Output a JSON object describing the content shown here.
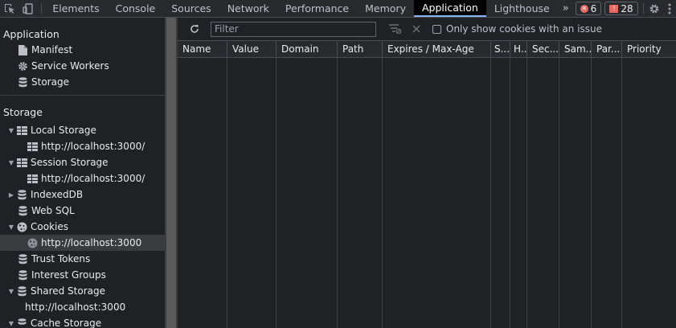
{
  "topbar": {
    "tabs": [
      "Elements",
      "Console",
      "Sources",
      "Network",
      "Performance",
      "Memory",
      "Application",
      "Lighthouse"
    ],
    "active_tab": "Application",
    "errors_count": "6",
    "issues_count": "28"
  },
  "sidebar": {
    "application_title": "Application",
    "application_items": [
      "Manifest",
      "Service Workers",
      "Storage"
    ],
    "storage_title": "Storage",
    "local_storage": "Local Storage",
    "local_storage_origin": "http://localhost:3000/",
    "session_storage": "Session Storage",
    "session_storage_origin": "http://localhost:3000/",
    "indexeddb": "IndexedDB",
    "websql": "Web SQL",
    "cookies": "Cookies",
    "cookies_origin": "http://localhost:3000",
    "trust_tokens": "Trust Tokens",
    "interest_groups": "Interest Groups",
    "shared_storage": "Shared Storage",
    "shared_storage_origin": "http://localhost:3000",
    "cache_storage": "Cache Storage"
  },
  "toolbar": {
    "filter_placeholder": "Filter",
    "only_issues_label": "Only show cookies with an issue"
  },
  "table": {
    "columns": [
      "Name",
      "Value",
      "Domain",
      "Path",
      "Expires / Max-Age",
      "S...",
      "H...",
      "Sec...",
      "Sam...",
      "Par...",
      "Priority"
    ]
  },
  "colors": {
    "background": "#202124",
    "toolbar": "#292a2d",
    "active_tab_underline": "#8ab4f8",
    "error_badge": "#e46962",
    "selected_row": "#393b3f"
  }
}
